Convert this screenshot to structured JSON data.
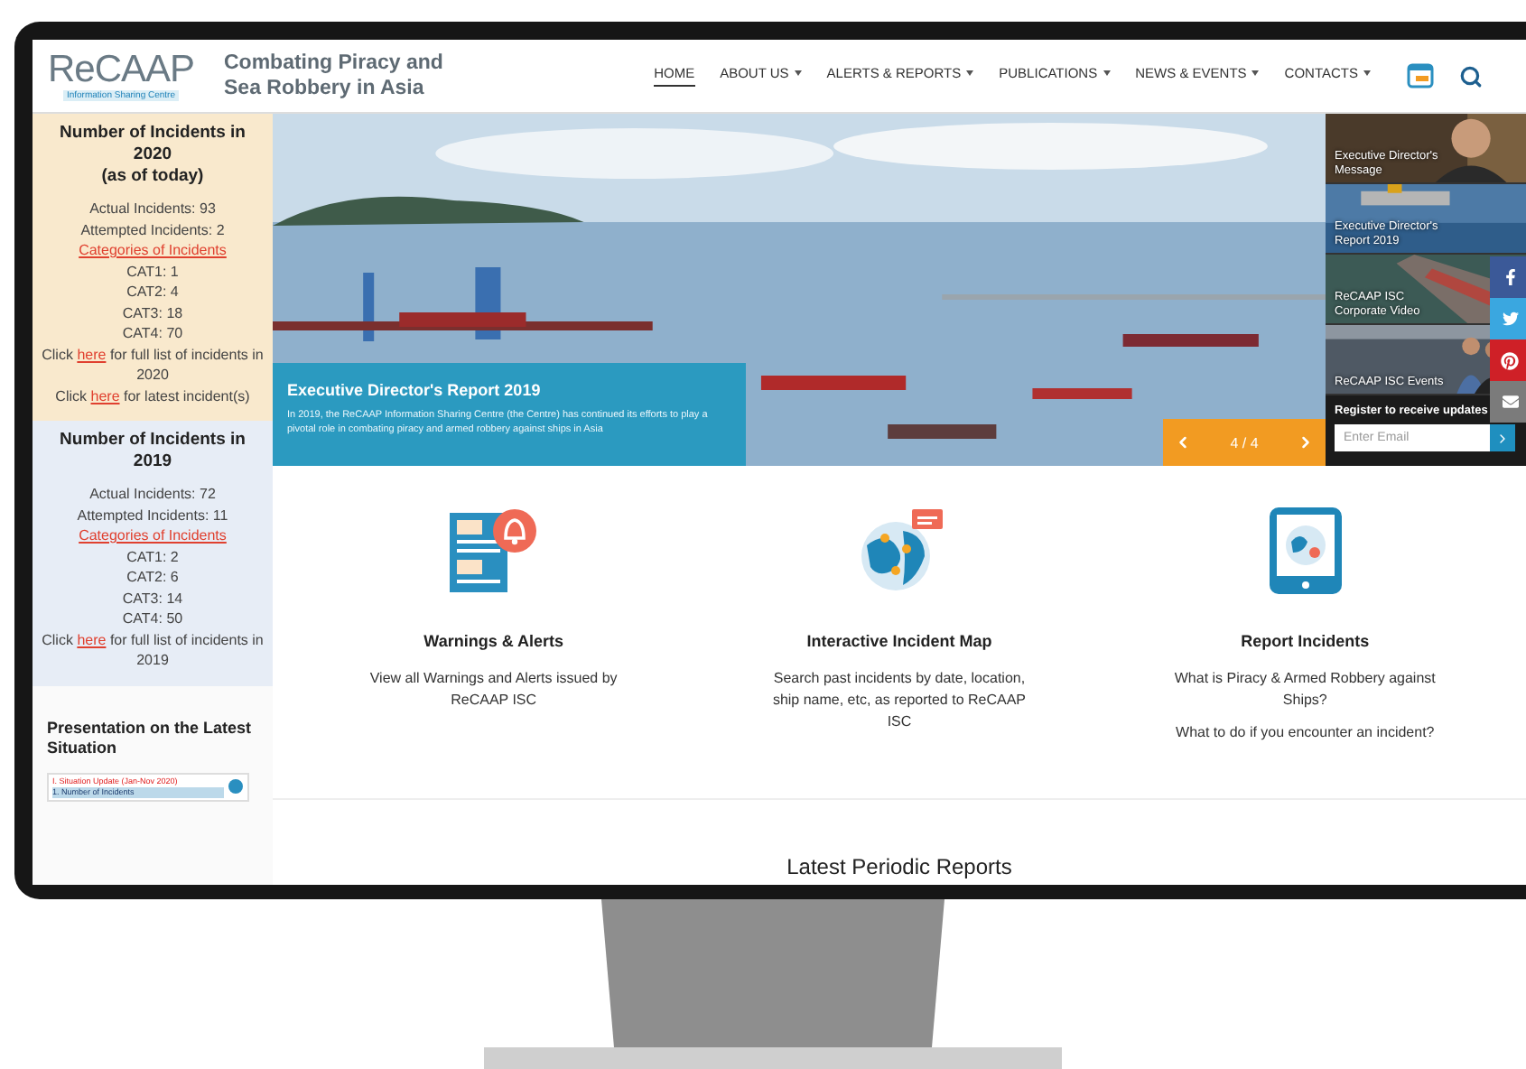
{
  "header": {
    "logo_name": "ReCAAP",
    "logo_tagline": "Information Sharing Centre",
    "title": "Combating Piracy and Sea Robbery in Asia",
    "nav": [
      {
        "label": "HOME",
        "selected": true,
        "has_menu": false
      },
      {
        "label": "ABOUT US",
        "selected": false,
        "has_menu": true
      },
      {
        "label": "ALERTS & REPORTS",
        "selected": false,
        "has_menu": true
      },
      {
        "label": "PUBLICATIONS",
        "selected": false,
        "has_menu": true
      },
      {
        "label": "NEWS & EVENTS",
        "selected": false,
        "has_menu": true
      },
      {
        "label": "CONTACTS",
        "selected": false,
        "has_menu": true
      }
    ]
  },
  "sidebar": {
    "blocks": [
      {
        "color": "#f9e9cd",
        "title": "Number of Incidents in 2020",
        "subtitle": "(as of today)",
        "lines": [
          {
            "kind": "text",
            "text": "Actual Incidents: 93"
          },
          {
            "kind": "text",
            "text": "Attempted Incidents: 2"
          },
          {
            "kind": "link",
            "text": "Categories of Incidents"
          },
          {
            "kind": "text",
            "text": "CAT1: 1"
          },
          {
            "kind": "text",
            "text": "CAT2: 4"
          },
          {
            "kind": "text",
            "text": "CAT3: 18"
          },
          {
            "kind": "text",
            "text": "CAT4: 70"
          },
          {
            "kind": "sentence",
            "before": "Click",
            "link": "here",
            "after": "for full list of incidents in 2020"
          },
          {
            "kind": "sentence",
            "before": "Click",
            "link": "here",
            "after": "for latest incident(s)"
          }
        ]
      },
      {
        "color": "#e7edf6",
        "title": "Number of Incidents in 2019",
        "lines": [
          {
            "kind": "text",
            "text": "Actual Incidents: 72"
          },
          {
            "kind": "text",
            "text": "Attempted Incidents: 11"
          },
          {
            "kind": "link",
            "text": "Categories of Incidents"
          },
          {
            "kind": "text",
            "text": "CAT1: 2"
          },
          {
            "kind": "text",
            "text": "CAT2: 6"
          },
          {
            "kind": "text",
            "text": "CAT3: 14"
          },
          {
            "kind": "text",
            "text": "CAT4: 50"
          },
          {
            "kind": "sentence",
            "before": "Click",
            "link": "here",
            "after": "for full list of incidents in 2019"
          }
        ]
      }
    ],
    "presentation": {
      "title": "Presentation on the Latest Situation",
      "slide_lines": [
        "I. Situation Update (Jan-Nov 2020)",
        "1. Number of Incidents"
      ]
    }
  },
  "hero": {
    "caption_title": "Executive Director's Report 2019",
    "caption_text": "In 2019, the ReCAAP Information Sharing Centre (the Centre) has continued its efforts to play a pivotal role in combating piracy and armed robbery against ships in Asia",
    "counter": "4 / 4"
  },
  "thumbnails": [
    {
      "label": "Executive Director's Message"
    },
    {
      "label": "Executive Director's Report 2019"
    },
    {
      "label": "ReCAAP ISC Corporate Video"
    },
    {
      "label": "ReCAAP ISC Events"
    }
  ],
  "register": {
    "title": "Register to receive updates",
    "placeholder": "Enter Email"
  },
  "share": [
    {
      "kind": "facebook",
      "color": "#3b5998"
    },
    {
      "kind": "twitter",
      "color": "#3aa7e0"
    },
    {
      "kind": "pinterest",
      "color": "#cf2027"
    },
    {
      "kind": "email",
      "color": "#7b7b7b"
    }
  ],
  "features": [
    {
      "kind": "alerts",
      "title": "Warnings & Alerts",
      "paragraphs": [
        "View all Warnings and Alerts issued by ReCAAP ISC"
      ]
    },
    {
      "kind": "map",
      "title": "Interactive Incident Map",
      "paragraphs": [
        "Search past incidents by date, location, ship name, etc, as reported to ReCAAP ISC"
      ]
    },
    {
      "kind": "report",
      "title": "Report Incidents",
      "paragraphs": [
        "What is Piracy & Armed Robbery against Ships?",
        "What to do if you encounter an incident?"
      ]
    }
  ],
  "reports_heading": "Latest Periodic Reports"
}
